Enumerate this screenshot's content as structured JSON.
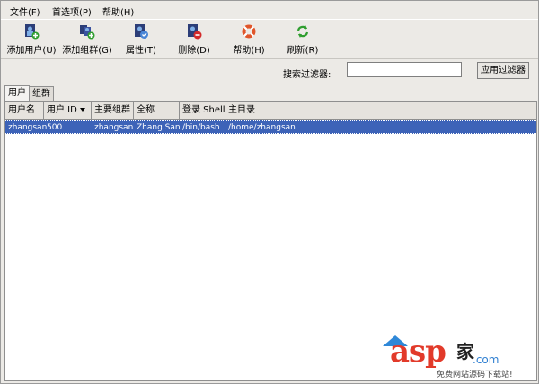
{
  "menu": {
    "file": "文件(F)",
    "preferences": "首选项(P)",
    "help": "帮助(H)"
  },
  "toolbar": {
    "add_user": "添加用户(U)",
    "add_group": "添加组群(G)",
    "properties": "属性(T)",
    "delete": "删除(D)",
    "help": "帮助(H)",
    "refresh": "刷新(R)"
  },
  "search": {
    "label": "搜索过滤器:",
    "value": "",
    "apply": "应用过滤器"
  },
  "tabs": [
    "用户",
    "组群"
  ],
  "table": {
    "columns": [
      "用户名",
      "用户 ID",
      "主要组群",
      "全称",
      "登录 Shell",
      "主目录"
    ],
    "rows": [
      [
        "zhangsan",
        "500",
        "zhangsan",
        "Zhang San",
        "/bin/bash",
        "/home/zhangsan"
      ]
    ]
  },
  "watermark": {
    "brand": "asp",
    "cn": "家",
    "domain": ".com",
    "tagline": "免费网站源码下载站!"
  },
  "colors": {
    "selected_row": "#3d63b8",
    "window_bg": "#eceae6"
  }
}
